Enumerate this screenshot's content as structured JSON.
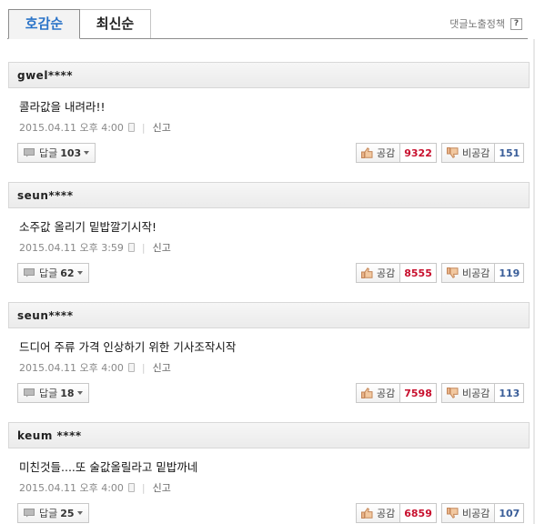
{
  "tabs": [
    {
      "label": "호감순",
      "active": true
    },
    {
      "label": "최신순",
      "active": false
    }
  ],
  "policy_label": "댓글노출정책",
  "policy_icon": "?",
  "colors": {
    "accent": "#2a73c8",
    "like": "#c8102e",
    "dislike": "#3a5e99"
  },
  "comments": [
    {
      "user": "gwel****",
      "text": "콜라값을 내려라!!",
      "date": "2015.04.11 오후 4:00",
      "report": "신고",
      "reply_label": "답글",
      "reply_count": "103",
      "like_label": "공감",
      "like_count": "9322",
      "dislike_label": "비공감",
      "dislike_count": "151"
    },
    {
      "user": "seun****",
      "text": "소주값 올리기 밑밥깔기시작!",
      "date": "2015.04.11 오후 3:59",
      "report": "신고",
      "reply_label": "답글",
      "reply_count": "62",
      "like_label": "공감",
      "like_count": "8555",
      "dislike_label": "비공감",
      "dislike_count": "119"
    },
    {
      "user": "seun****",
      "text": "드디어 주류 가격 인상하기 위한 기사조작시작",
      "date": "2015.04.11 오후 4:00",
      "report": "신고",
      "reply_label": "답글",
      "reply_count": "18",
      "like_label": "공감",
      "like_count": "7598",
      "dislike_label": "비공감",
      "dislike_count": "113"
    },
    {
      "user": "keum ****",
      "text": "미친것들....또 술값올릴라고 밑밥까네",
      "date": "2015.04.11 오후 4:00",
      "report": "신고",
      "reply_label": "답글",
      "reply_count": "25",
      "like_label": "공감",
      "like_count": "6859",
      "dislike_label": "비공감",
      "dislike_count": "107"
    }
  ]
}
